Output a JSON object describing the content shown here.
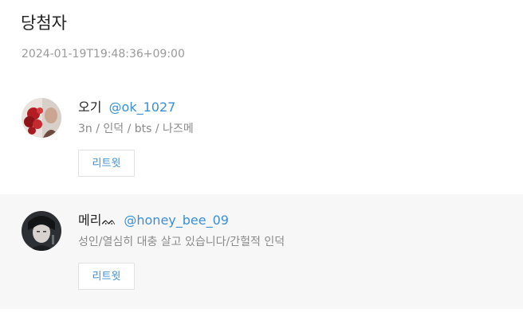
{
  "header": {
    "title": "당첨자",
    "timestamp": "2024-01-19T19:48:36+09:00"
  },
  "winners": [
    {
      "display_name": "오기",
      "handle": "@ok_1027",
      "bio": "3n / 인덕 / bts / 나즈메",
      "retweet_label": "리트윗",
      "avatar_icon": "profile-photo-red-roses"
    },
    {
      "display_name": "메리ᨐ",
      "handle": "@honey_bee_09",
      "bio": "성인/열심히 대충 살고 있습니다/간헐적 인덕",
      "retweet_label": "리트윗",
      "avatar_icon": "profile-photo-dark-portrait"
    }
  ],
  "colors": {
    "link": "#3b8fd6",
    "muted_text": "#8a8a8a",
    "row_alt_background": "#f7f7f7"
  }
}
